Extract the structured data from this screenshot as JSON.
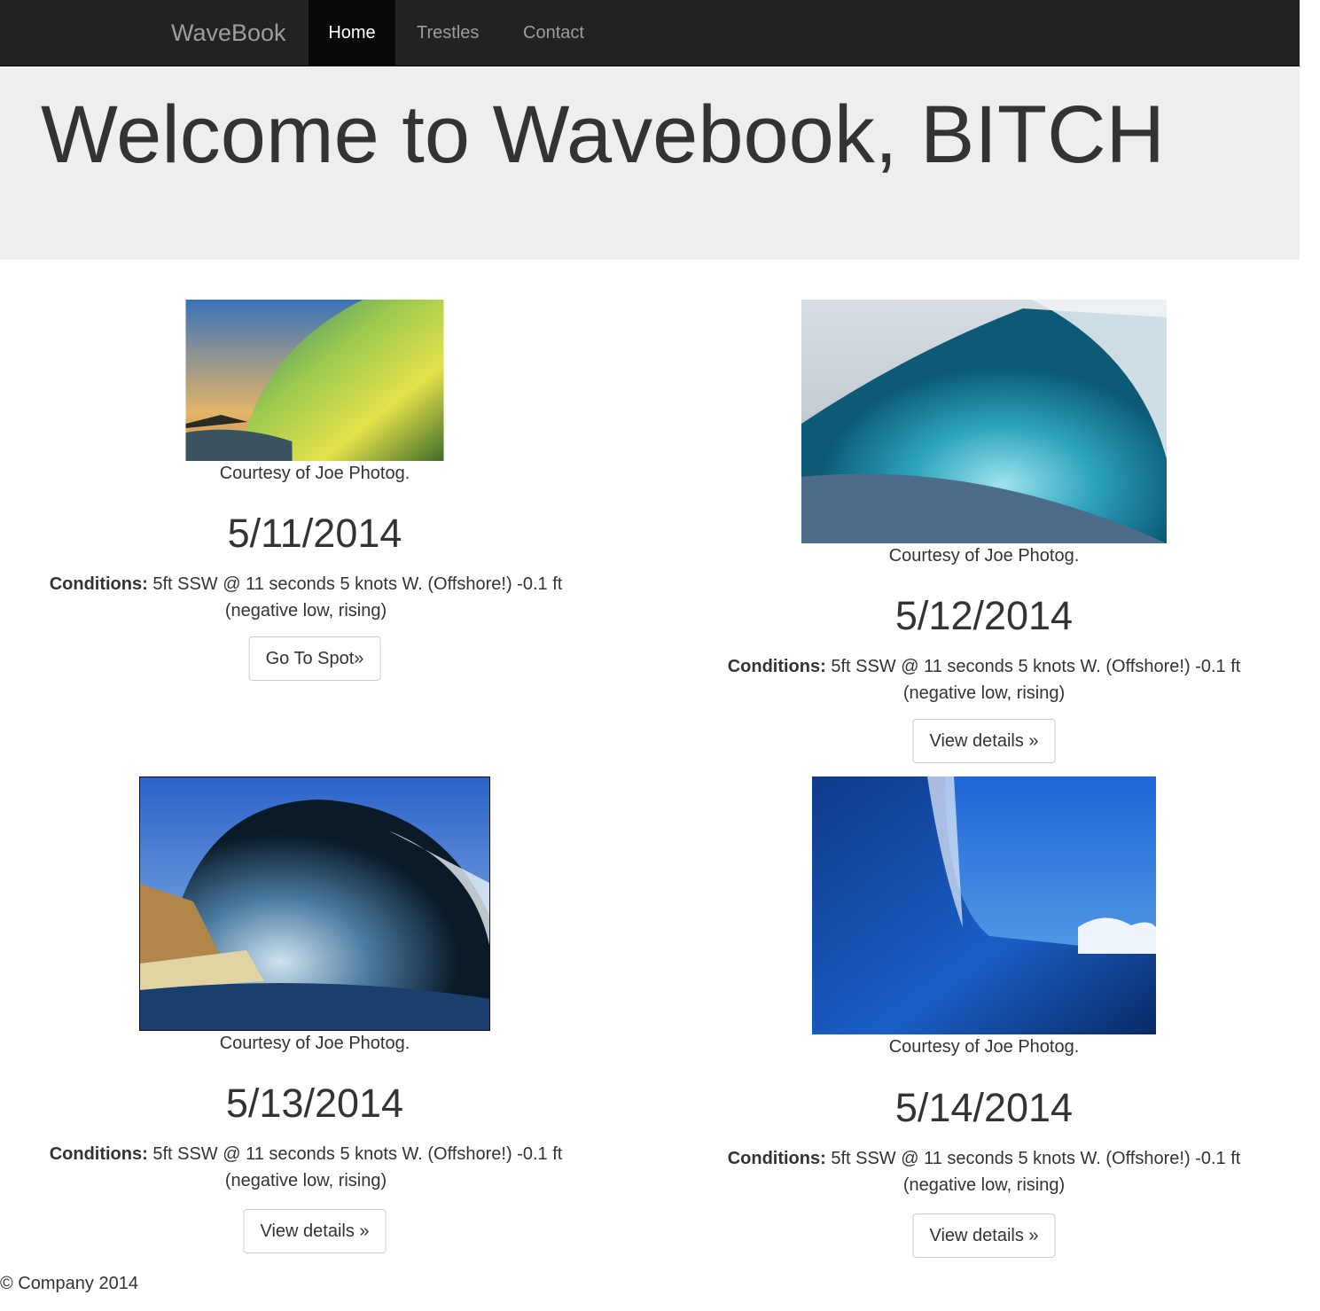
{
  "nav": {
    "brand": "WaveBook",
    "items": [
      {
        "label": "Home",
        "active": true
      },
      {
        "label": "Trestles",
        "active": false
      },
      {
        "label": "Contact",
        "active": false
      }
    ]
  },
  "jumbotron": {
    "heading": "Welcome to Wavebook, BITCH"
  },
  "cards": [
    {
      "caption": "Courtesy of Joe Photog.",
      "date": "5/11/2014",
      "conditions_label": "Conditions:",
      "conditions_text": " 5ft SSW @ 11 seconds 5 knots W. (Offshore!) -0.1 ft (negative low, rising)",
      "button": "Go To Spot»"
    },
    {
      "caption": "Courtesy of Joe Photog.",
      "date": "5/12/2014",
      "conditions_label": "Conditions:",
      "conditions_text": " 5ft SSW @ 11 seconds 5 knots W. (Offshore!) -0.1 ft (negative low, rising)",
      "button": "View details »"
    },
    {
      "caption": "Courtesy of Joe Photog.",
      "date": "5/13/2014",
      "conditions_label": "Conditions:",
      "conditions_text": " 5ft SSW @ 11 seconds 5 knots W. (Offshore!) -0.1 ft (negative low, rising)",
      "button": "View details »"
    },
    {
      "caption": "Courtesy of Joe Photog.",
      "date": "5/14/2014",
      "conditions_label": "Conditions:",
      "conditions_text": " 5ft SSW @ 11 seconds 5 knots W. (Offshore!) -0.1 ft (negative low, rising)",
      "button": "View details »"
    }
  ],
  "footer": {
    "text": "© Company 2014"
  }
}
